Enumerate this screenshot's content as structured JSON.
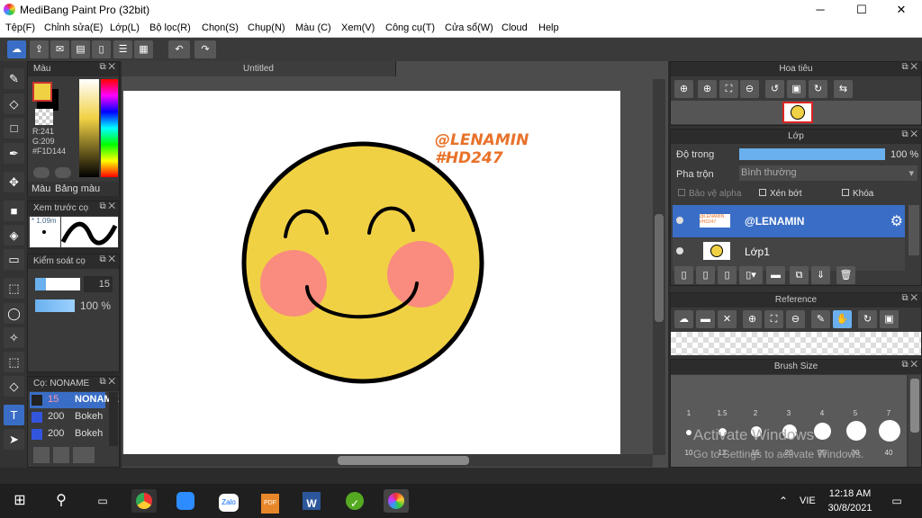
{
  "window": {
    "title": "MediBang Paint Pro (32bit)",
    "min": "─",
    "max": "☐",
    "close": "✕"
  },
  "menu": [
    "Tệp(F)",
    "Chỉnh sửa(E)",
    "Lớp(L)",
    "Bộ lọc(R)",
    "Chọn(S)",
    "Chụp(N)",
    "Màu (C)",
    "Xem(V)",
    "Công cụ(T)",
    "Cửa sổ(W)",
    "Cloud",
    "Help"
  ],
  "color_panel": {
    "title": "Màu",
    "r": "R:241",
    "g": "G:209",
    "hex": "#F1D144",
    "tab1": "Màu",
    "tab2": "Bảng màu",
    "fg": "#F1D144",
    "bg": "#000000"
  },
  "preview_panel": {
    "title": "Xem trước cọ",
    "size": "* 1.09m"
  },
  "brush_control": {
    "title": "Kiểm soát cọ",
    "size": "15",
    "opacity": "100 %"
  },
  "brush_list": {
    "title": "Cọ: NONAME",
    "items": [
      {
        "size": "15",
        "name": "NONAME",
        "color": "#222222"
      },
      {
        "size": "200",
        "name": "Bokeh",
        "color": "#3355dd"
      },
      {
        "size": "200",
        "name": "Bokeh",
        "color": "#3355dd"
      }
    ]
  },
  "canvas": {
    "tab": "Untitled",
    "text1": "@LENAMIN",
    "text2": "#HD247",
    "text_color": "#E8722A",
    "face_color": "#F1D144",
    "cheek_color": "#F98C7E"
  },
  "navigator": {
    "title": "Hoa tiêu"
  },
  "layers": {
    "title": "Lớp",
    "opacity_label": "Độ trong",
    "opacity_value": "100 %",
    "opacity": 1.0,
    "blend_label": "Pha trộn",
    "blend_value": "Bình thường",
    "protect_alpha": "Bảo vệ alpha",
    "clip": "Xén bớt",
    "lock": "Khóa",
    "items": [
      {
        "name": "@LENAMIN",
        "selected": true
      },
      {
        "name": "Lớp1",
        "selected": false
      }
    ],
    "thumb_text": "@LENAMIN #HD247"
  },
  "reference": {
    "title": "Reference"
  },
  "brush_size": {
    "title": "Brush Size",
    "row1": [
      "1",
      "1.5",
      "2",
      "3",
      "4",
      "5",
      "7"
    ],
    "row2": [
      "10",
      "12",
      "15",
      "20",
      "25",
      "30",
      "40"
    ]
  },
  "watermark": {
    "line1": "Activate Windows",
    "line2": "Go to Settings to activate Windows."
  },
  "taskbar": {
    "lang": "VIE",
    "time": "12:18 AM",
    "date": "30/8/2021",
    "apps": [
      "Chrome",
      "Zoom",
      "Zalo",
      "PDF",
      "Word",
      "Corel",
      "MediBang"
    ]
  }
}
